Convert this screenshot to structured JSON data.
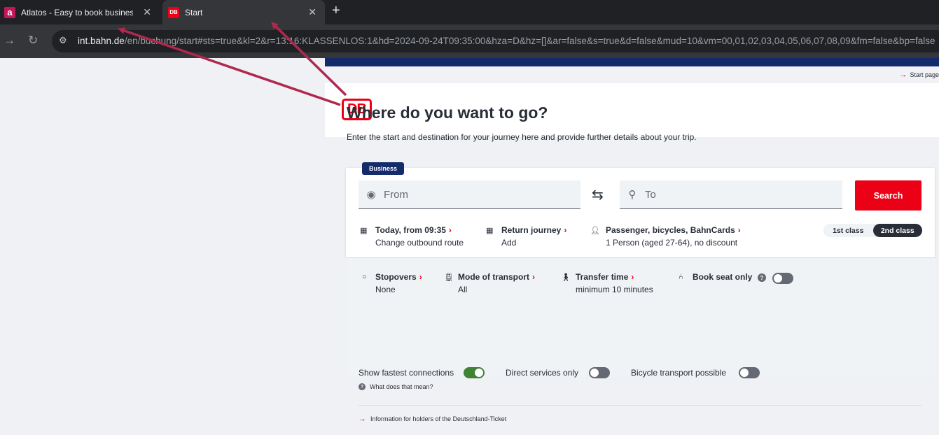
{
  "browser": {
    "tabs": [
      {
        "title": "Atlatos - Easy to book business",
        "favicon": "a"
      },
      {
        "title": "Start",
        "favicon": "DB"
      }
    ],
    "url_host": "int.bahn.de",
    "url_path": "/en/buchung/start#sts=true&kl=2&r=13:16:KLASSENLOS:1&hd=2024-09-24T09:35:00&hza=D&hz=[]&ar=false&s=true&d=false&mud=10&vm=00,01,02,03,04,05,06,07,08,09&fm=false&bp=false"
  },
  "header": {
    "start_page_link": "Start page",
    "logo_text": "DB"
  },
  "main": {
    "title": "Where do you want to go?",
    "subtitle": "Enter the start and destination for your journey here and provide further details about your trip."
  },
  "search": {
    "badge": "Business",
    "from_placeholder": "From",
    "to_placeholder": "To",
    "search_label": "Search",
    "date_title": "Today, from 09:35",
    "date_sub": "Change outbound route",
    "return_title": "Return journey",
    "return_sub": "Add",
    "passenger_title": "Passenger, bicycles, BahnCards",
    "passenger_sub": "1 Person (aged 27-64), no discount",
    "class_first": "1st class",
    "class_second": "2nd class",
    "selected_class": "2nd class"
  },
  "options": {
    "stopovers_title": "Stopovers",
    "stopovers_value": "None",
    "mode_title": "Mode of transport",
    "mode_value": "All",
    "transfer_title": "Transfer time",
    "transfer_value": "minimum 10 minutes",
    "book_seat_label": "Book seat only",
    "book_seat_on": false,
    "fastest_label": "Show fastest connections",
    "fastest_on": true,
    "direct_label": "Direct services only",
    "direct_on": false,
    "bicycle_label": "Bicycle transport possible",
    "bicycle_on": false,
    "what_link": "What does that mean?",
    "info_link": "Information for holders of the Deutschland-Ticket"
  },
  "colors": {
    "db_red": "#ec0016",
    "navy": "#132a6b",
    "annotation": "#b0284e",
    "toggle_on": "#408335"
  }
}
